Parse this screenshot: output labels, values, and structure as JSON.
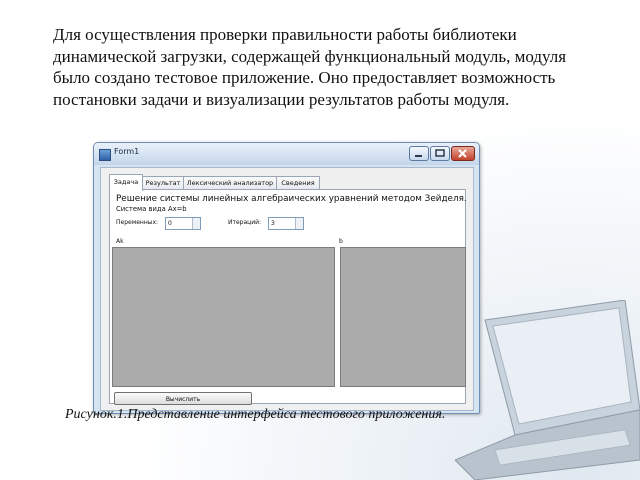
{
  "slide": {
    "intro_text": "Для осуществления проверки правильности работы библиотеки динамической загрузки, содержащей функциональный модуль, модуля было создано тестовое приложение. Оно предоставляет возможность постановки задачи и визуализации результатов работы модуля.",
    "caption": "Рисунок.1.Представление интерфейса тестового приложения."
  },
  "window": {
    "title": "Form1"
  },
  "tabs": [
    {
      "label": "Задача",
      "active": true
    },
    {
      "label": "Результат",
      "active": false
    },
    {
      "label": "Лексический анализатор",
      "active": false
    },
    {
      "label": "Сведения",
      "active": false
    }
  ],
  "task_panel": {
    "heading": "Решение системы линейных алгебраических уравнений методом Зейделя.",
    "subheading": "Система вида Ax=b",
    "variables_label": "Переменных:",
    "variables_value": "0",
    "iterations_label": "Итераций:",
    "iterations_value": "3",
    "matrix_label": "Ak",
    "vector_label": "b",
    "calculate_button": "Вычислить"
  },
  "colors": {
    "grid_fill": "#ababab",
    "window_frame": "#d6e3f1",
    "close_button": "#c4412a"
  }
}
